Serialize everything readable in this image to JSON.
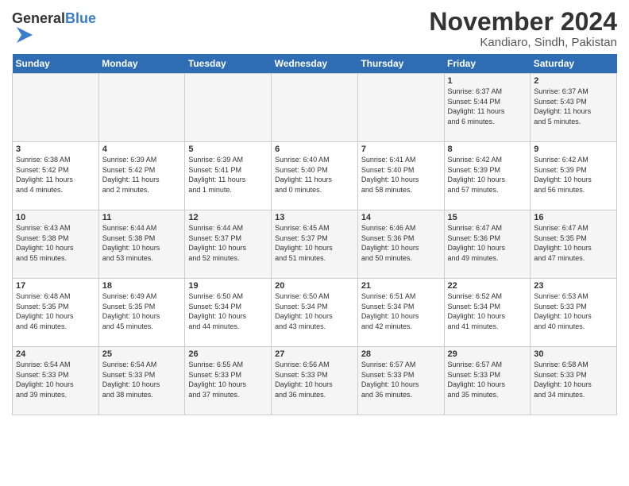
{
  "header": {
    "logo_general": "General",
    "logo_blue": "Blue",
    "month_title": "November 2024",
    "location": "Kandiaro, Sindh, Pakistan"
  },
  "weekdays": [
    "Sunday",
    "Monday",
    "Tuesday",
    "Wednesday",
    "Thursday",
    "Friday",
    "Saturday"
  ],
  "weeks": [
    [
      {
        "day": "",
        "info": ""
      },
      {
        "day": "",
        "info": ""
      },
      {
        "day": "",
        "info": ""
      },
      {
        "day": "",
        "info": ""
      },
      {
        "day": "",
        "info": ""
      },
      {
        "day": "1",
        "info": "Sunrise: 6:37 AM\nSunset: 5:44 PM\nDaylight: 11 hours\nand 6 minutes."
      },
      {
        "day": "2",
        "info": "Sunrise: 6:37 AM\nSunset: 5:43 PM\nDaylight: 11 hours\nand 5 minutes."
      }
    ],
    [
      {
        "day": "3",
        "info": "Sunrise: 6:38 AM\nSunset: 5:42 PM\nDaylight: 11 hours\nand 4 minutes."
      },
      {
        "day": "4",
        "info": "Sunrise: 6:39 AM\nSunset: 5:42 PM\nDaylight: 11 hours\nand 2 minutes."
      },
      {
        "day": "5",
        "info": "Sunrise: 6:39 AM\nSunset: 5:41 PM\nDaylight: 11 hours\nand 1 minute."
      },
      {
        "day": "6",
        "info": "Sunrise: 6:40 AM\nSunset: 5:40 PM\nDaylight: 11 hours\nand 0 minutes."
      },
      {
        "day": "7",
        "info": "Sunrise: 6:41 AM\nSunset: 5:40 PM\nDaylight: 10 hours\nand 58 minutes."
      },
      {
        "day": "8",
        "info": "Sunrise: 6:42 AM\nSunset: 5:39 PM\nDaylight: 10 hours\nand 57 minutes."
      },
      {
        "day": "9",
        "info": "Sunrise: 6:42 AM\nSunset: 5:39 PM\nDaylight: 10 hours\nand 56 minutes."
      }
    ],
    [
      {
        "day": "10",
        "info": "Sunrise: 6:43 AM\nSunset: 5:38 PM\nDaylight: 10 hours\nand 55 minutes."
      },
      {
        "day": "11",
        "info": "Sunrise: 6:44 AM\nSunset: 5:38 PM\nDaylight: 10 hours\nand 53 minutes."
      },
      {
        "day": "12",
        "info": "Sunrise: 6:44 AM\nSunset: 5:37 PM\nDaylight: 10 hours\nand 52 minutes."
      },
      {
        "day": "13",
        "info": "Sunrise: 6:45 AM\nSunset: 5:37 PM\nDaylight: 10 hours\nand 51 minutes."
      },
      {
        "day": "14",
        "info": "Sunrise: 6:46 AM\nSunset: 5:36 PM\nDaylight: 10 hours\nand 50 minutes."
      },
      {
        "day": "15",
        "info": "Sunrise: 6:47 AM\nSunset: 5:36 PM\nDaylight: 10 hours\nand 49 minutes."
      },
      {
        "day": "16",
        "info": "Sunrise: 6:47 AM\nSunset: 5:35 PM\nDaylight: 10 hours\nand 47 minutes."
      }
    ],
    [
      {
        "day": "17",
        "info": "Sunrise: 6:48 AM\nSunset: 5:35 PM\nDaylight: 10 hours\nand 46 minutes."
      },
      {
        "day": "18",
        "info": "Sunrise: 6:49 AM\nSunset: 5:35 PM\nDaylight: 10 hours\nand 45 minutes."
      },
      {
        "day": "19",
        "info": "Sunrise: 6:50 AM\nSunset: 5:34 PM\nDaylight: 10 hours\nand 44 minutes."
      },
      {
        "day": "20",
        "info": "Sunrise: 6:50 AM\nSunset: 5:34 PM\nDaylight: 10 hours\nand 43 minutes."
      },
      {
        "day": "21",
        "info": "Sunrise: 6:51 AM\nSunset: 5:34 PM\nDaylight: 10 hours\nand 42 minutes."
      },
      {
        "day": "22",
        "info": "Sunrise: 6:52 AM\nSunset: 5:34 PM\nDaylight: 10 hours\nand 41 minutes."
      },
      {
        "day": "23",
        "info": "Sunrise: 6:53 AM\nSunset: 5:33 PM\nDaylight: 10 hours\nand 40 minutes."
      }
    ],
    [
      {
        "day": "24",
        "info": "Sunrise: 6:54 AM\nSunset: 5:33 PM\nDaylight: 10 hours\nand 39 minutes."
      },
      {
        "day": "25",
        "info": "Sunrise: 6:54 AM\nSunset: 5:33 PM\nDaylight: 10 hours\nand 38 minutes."
      },
      {
        "day": "26",
        "info": "Sunrise: 6:55 AM\nSunset: 5:33 PM\nDaylight: 10 hours\nand 37 minutes."
      },
      {
        "day": "27",
        "info": "Sunrise: 6:56 AM\nSunset: 5:33 PM\nDaylight: 10 hours\nand 36 minutes."
      },
      {
        "day": "28",
        "info": "Sunrise: 6:57 AM\nSunset: 5:33 PM\nDaylight: 10 hours\nand 36 minutes."
      },
      {
        "day": "29",
        "info": "Sunrise: 6:57 AM\nSunset: 5:33 PM\nDaylight: 10 hours\nand 35 minutes."
      },
      {
        "day": "30",
        "info": "Sunrise: 6:58 AM\nSunset: 5:33 PM\nDaylight: 10 hours\nand 34 minutes."
      }
    ]
  ]
}
